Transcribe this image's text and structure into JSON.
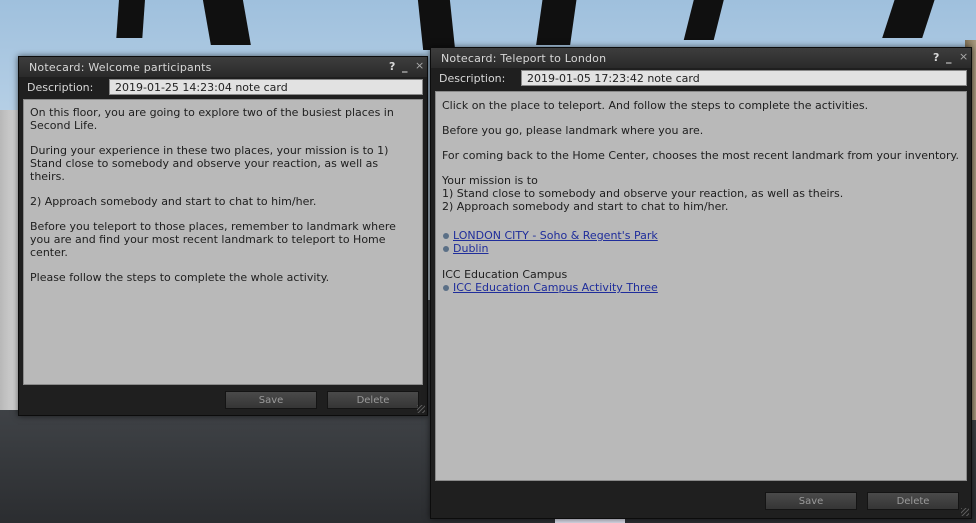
{
  "window1": {
    "title": "Notecard: Welcome participants",
    "help": "?",
    "minimize": "_",
    "close": "×",
    "description_label": "Description:",
    "description_value": "2019-01-25 14:23:04 note card",
    "paragraphs": [
      "On this floor,  you are going to explore two of the busiest places in Second Life.",
      "During your experience in these two places, your mission is to 1) Stand close to somebody and observe your reaction, as well as theirs.",
      "2) Approach somebody and start to chat to him/her.",
      "Before you teleport to those places, remember to landmark where you are and find your most recent landmark to teleport to Home center.",
      "Please follow the steps to complete the whole activity."
    ],
    "save_label": "Save",
    "delete_label": "Delete"
  },
  "window2": {
    "title": "Notecard: Teleport to London",
    "help": "?",
    "minimize": "_",
    "close": "×",
    "description_label": "Description:",
    "description_value": "2019-01-05 17:23:42 note card",
    "line1": "Click on the place to teleport. And follow the steps to complete the activities.",
    "line2": "Before you go, please landmark where you are.",
    "line3": "For coming back to the Home Center, chooses the most recent landmark from your inventory.",
    "mission_heading": "Your mission is to",
    "mission_1": "1) Stand close to somebody and observe your reaction, as well as theirs.",
    "mission_2": "2) Approach somebody and start to chat to him/her.",
    "landmarks": [
      "LONDON CITY - Soho & Regent's Park",
      "Dublin"
    ],
    "campus_heading": "ICC Education Campus",
    "campus_landmark": "ICC Education Campus Activity Three",
    "save_label": "Save",
    "delete_label": "Delete"
  }
}
